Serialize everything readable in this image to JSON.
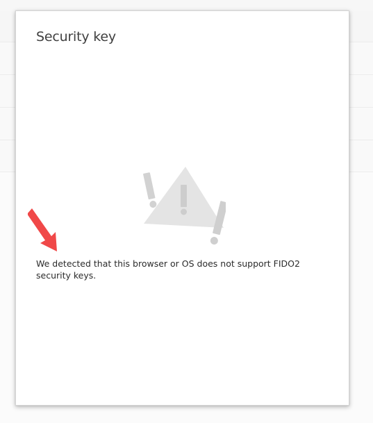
{
  "dialog": {
    "title": "Security key",
    "message": "We detected that this browser or OS does not support FIDO2 security keys."
  },
  "icons": {
    "illustration": "warning-triangle-exclamation-icon",
    "annotation": "red-arrow-icon"
  },
  "colors": {
    "arrow": "#f04848",
    "illustration": "#e4e4e4",
    "exclamation": "#cfcfcf",
    "title_text": "#404040",
    "body_text": "#2b2b2b"
  }
}
